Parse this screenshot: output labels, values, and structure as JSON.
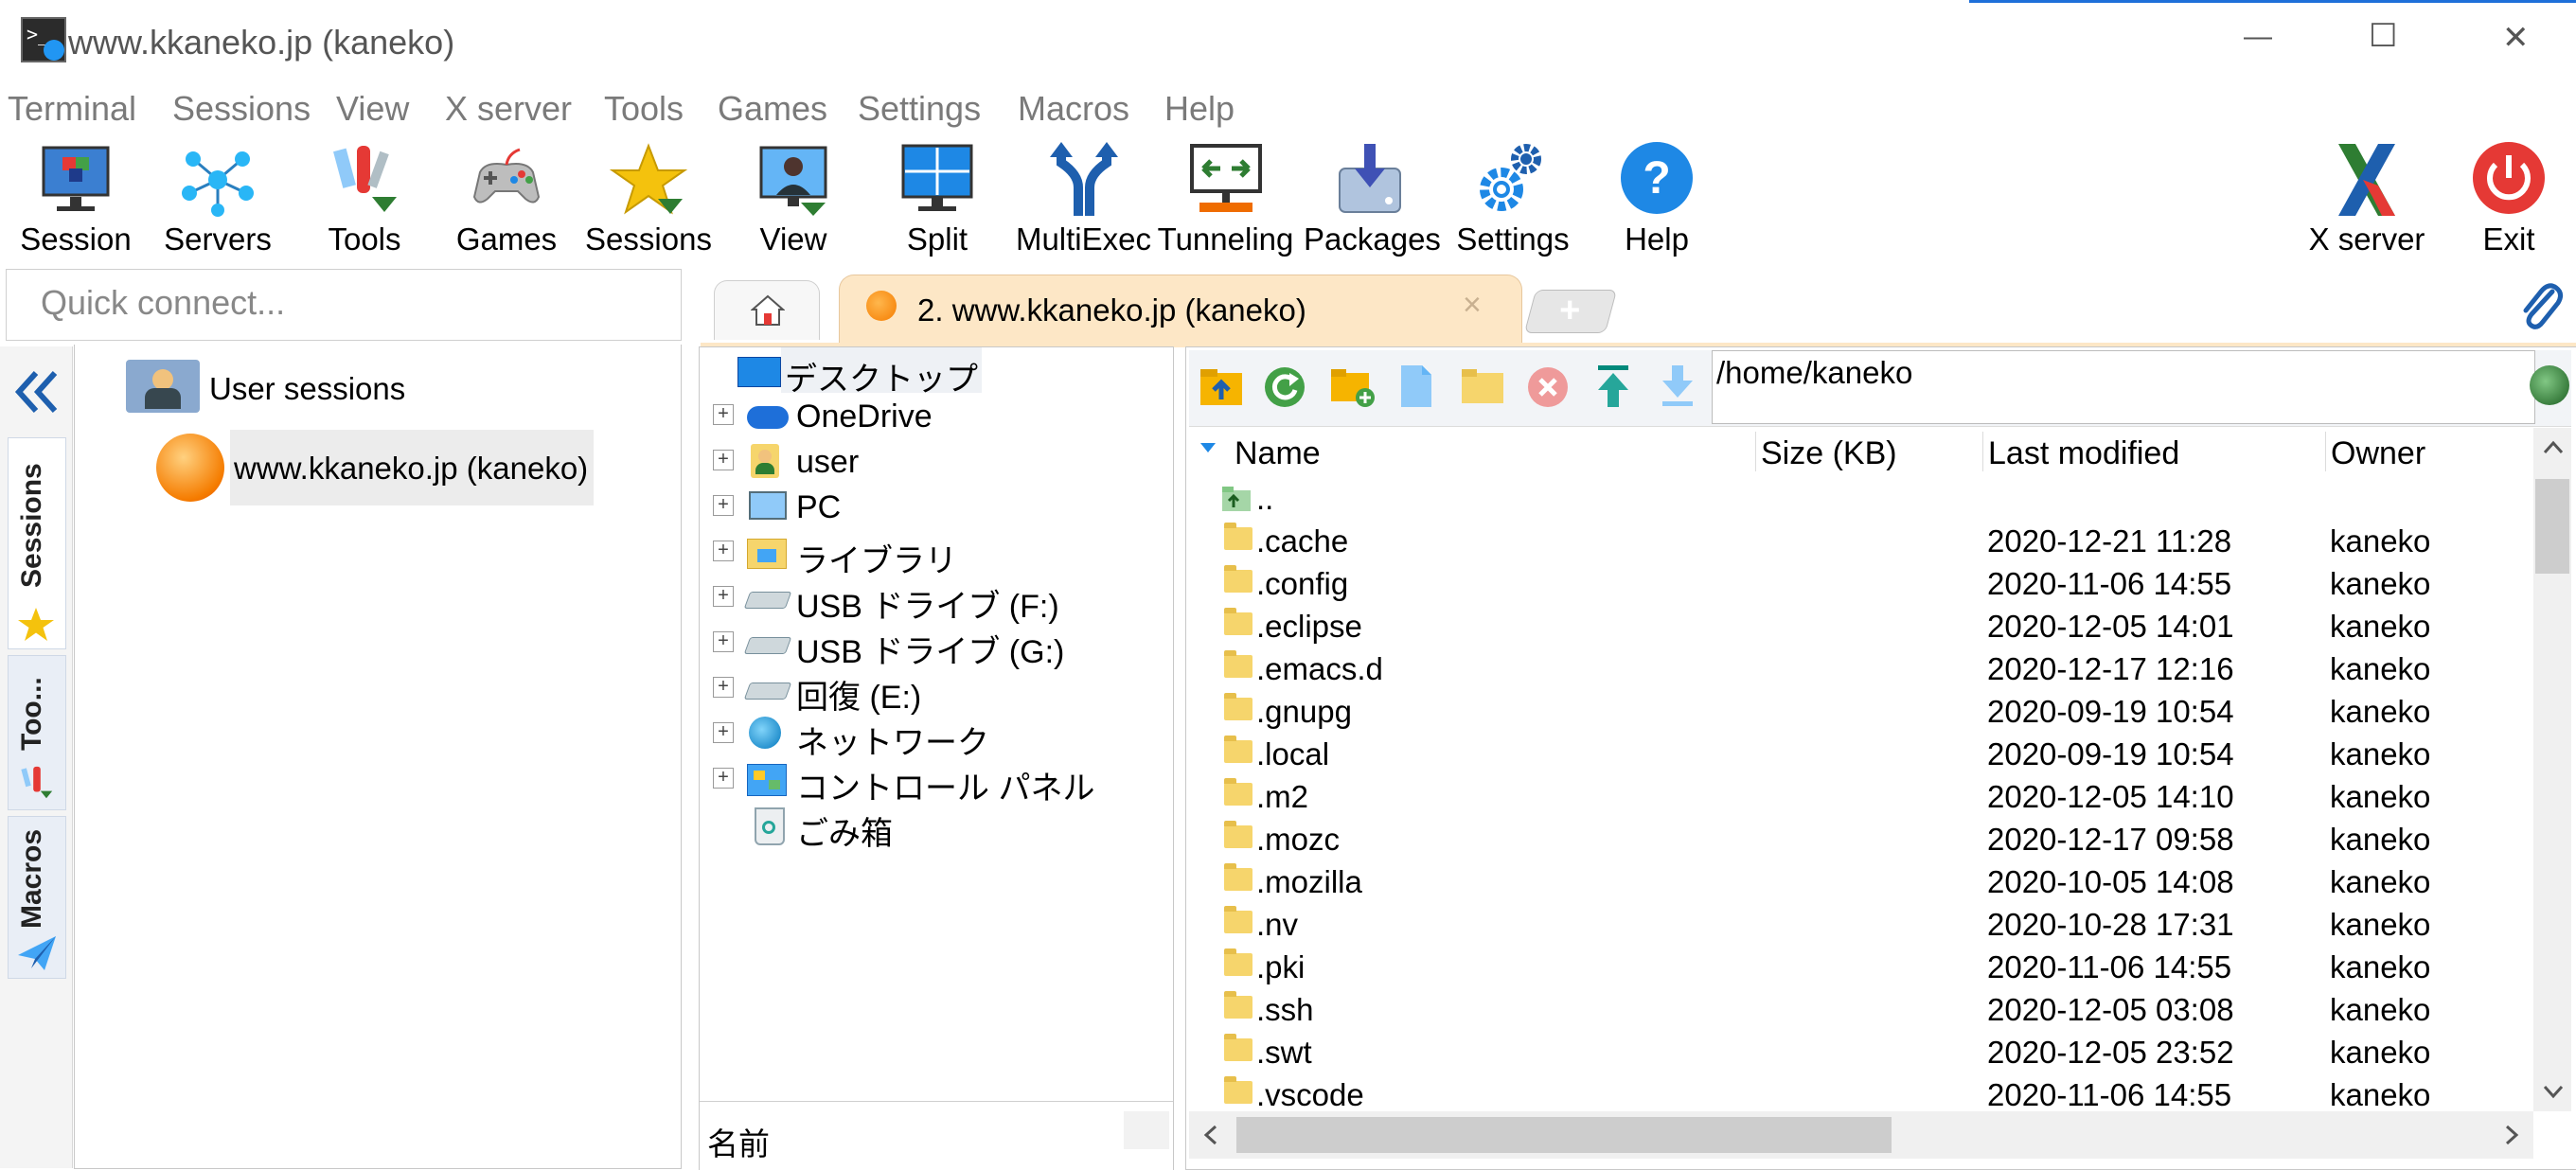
{
  "window": {
    "title": "www.kkaneko.jp (kaneko)",
    "minimize": "—",
    "maximize": "☐",
    "close": "✕"
  },
  "menu": [
    "Terminal",
    "Sessions",
    "View",
    "X server",
    "Tools",
    "Games",
    "Settings",
    "Macros",
    "Help"
  ],
  "toolbar": {
    "session": "Session",
    "servers": "Servers",
    "tools": "Tools",
    "games": "Games",
    "sessions": "Sessions",
    "view": "View",
    "split": "Split",
    "multiexec": "MultiExec",
    "tunneling": "Tunneling",
    "packages": "Packages",
    "settings": "Settings",
    "help": "Help",
    "xserver": "X server",
    "exit": "Exit"
  },
  "quick_connect": {
    "placeholder": "Quick connect..."
  },
  "tabs": {
    "home_icon": "home-icon",
    "active_label": "2. www.kkaneko.jp (kaneko)",
    "close": "×",
    "add": "+"
  },
  "side_tabs": {
    "sessions": "Sessions",
    "tools": "Too...",
    "macros": "Macros"
  },
  "sessions_tree": {
    "group": "User sessions",
    "session": "www.kkaneko.jp (kaneko)"
  },
  "local_tree": {
    "items": [
      "デスクトップ",
      "OneDrive",
      "user",
      "PC",
      "ライブラリ",
      "USB ドライブ (F:)",
      "USB ドライブ (G:)",
      "回復 (E:)",
      "ネットワーク",
      "コントロール パネル",
      "ごみ箱"
    ],
    "footer": "名前"
  },
  "remote": {
    "path": "/home/kaneko",
    "columns": {
      "name": "Name",
      "size": "Size (KB)",
      "modified": "Last modified",
      "owner": "Owner"
    },
    "parent": "..",
    "files": [
      {
        "name": ".cache",
        "modified": "2020-12-21 11:28",
        "owner": "kaneko"
      },
      {
        "name": ".config",
        "modified": "2020-11-06 14:55",
        "owner": "kaneko"
      },
      {
        "name": ".eclipse",
        "modified": "2020-12-05 14:01",
        "owner": "kaneko"
      },
      {
        "name": ".emacs.d",
        "modified": "2020-12-17 12:16",
        "owner": "kaneko"
      },
      {
        "name": ".gnupg",
        "modified": "2020-09-19 10:54",
        "owner": "kaneko"
      },
      {
        "name": ".local",
        "modified": "2020-09-19 10:54",
        "owner": "kaneko"
      },
      {
        "name": ".m2",
        "modified": "2020-12-05 14:10",
        "owner": "kaneko"
      },
      {
        "name": ".mozc",
        "modified": "2020-12-17 09:58",
        "owner": "kaneko"
      },
      {
        "name": ".mozilla",
        "modified": "2020-10-05 14:08",
        "owner": "kaneko"
      },
      {
        "name": ".nv",
        "modified": "2020-10-28 17:31",
        "owner": "kaneko"
      },
      {
        "name": ".pki",
        "modified": "2020-11-06 14:55",
        "owner": "kaneko"
      },
      {
        "name": ".ssh",
        "modified": "2020-12-05 03:08",
        "owner": "kaneko"
      },
      {
        "name": ".swt",
        "modified": "2020-12-05 23:52",
        "owner": "kaneko"
      },
      {
        "name": ".vscode",
        "modified": "2020-11-06 14:55",
        "owner": "kaneko"
      }
    ]
  },
  "colors": {
    "accent_tab": "#fde7c6",
    "toolbar_blue": "#1e88e5",
    "exit_red": "#e53935"
  }
}
